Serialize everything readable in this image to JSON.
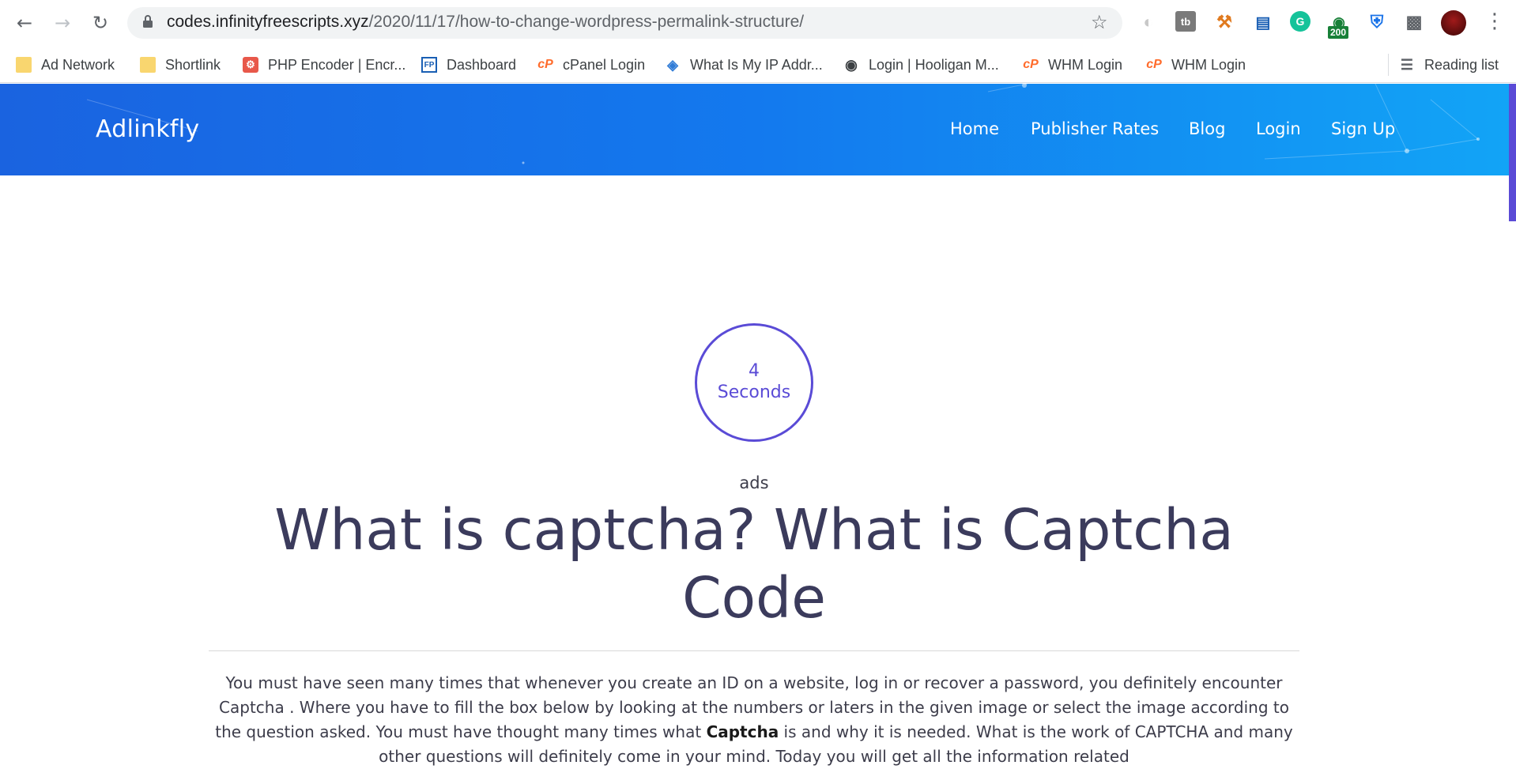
{
  "browser": {
    "url_host": "codes.infinityfreescripts.xyz",
    "url_path": "/2020/11/17/how-to-change-wordpress-permalink-structure/",
    "extension_badge": "200",
    "bookmarks": [
      {
        "label": "Ad Network",
        "icon": "folder-icon"
      },
      {
        "label": "Shortlink",
        "icon": "folder-icon"
      },
      {
        "label": "PHP Encoder | Encr...",
        "icon": "gear-icon"
      },
      {
        "label": "Dashboard",
        "icon": "fp-icon"
      },
      {
        "label": "cPanel Login",
        "icon": "cpanel-icon"
      },
      {
        "label": "What Is My IP Addr...",
        "icon": "globe-icon"
      },
      {
        "label": "Login | Hooligan M...",
        "icon": "globe-icon"
      },
      {
        "label": "WHM Login",
        "icon": "cpanel-icon"
      },
      {
        "label": "WHM Login",
        "icon": "cpanel-icon"
      }
    ],
    "reading_list_label": "Reading list"
  },
  "site": {
    "brand": "Adlinkfly",
    "nav": [
      "Home",
      "Publisher Rates",
      "Blog",
      "Login",
      "Sign Up"
    ]
  },
  "content": {
    "timer_number": "4",
    "timer_label": "Seconds",
    "ads_label": "ads",
    "title": "What is captcha? What is Captcha Code",
    "paragraph_part1": "You must have seen many times that whenever you create an ID on a website, log in or recover a password, you definitely encounter Captcha . Where you have to fill the box below by looking at the numbers or laters in the given image or select the image according to the question asked. You must have thought many times what ",
    "paragraph_bold": "Captcha",
    "paragraph_part2": " is and why it is needed. What is the work of CAPTCHA and many other questions will definitely come in your mind. Today you will get all the information related"
  },
  "colors": {
    "header_start": "#1a63e0",
    "header_end": "#12a4f6",
    "accent": "#5a4bd6",
    "title": "#3b3b5c"
  }
}
